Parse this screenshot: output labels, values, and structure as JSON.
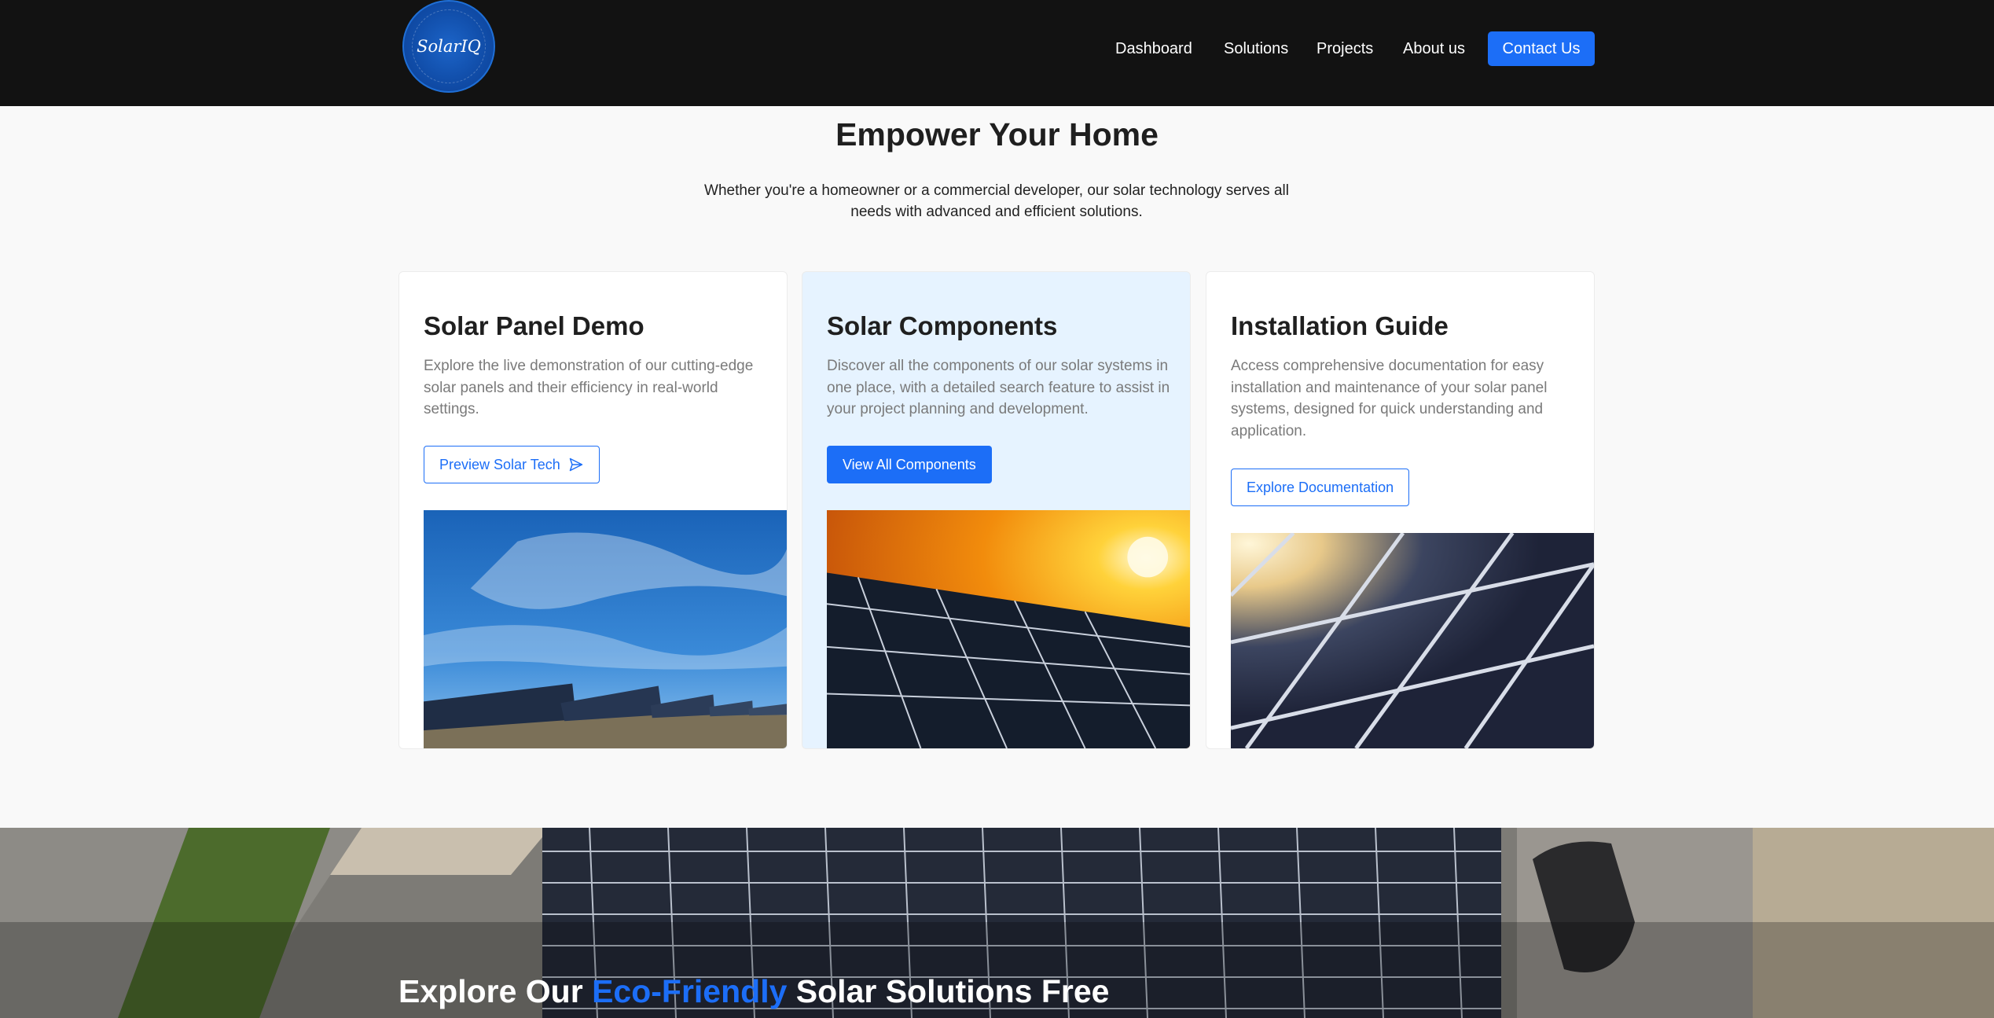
{
  "brand": {
    "logo_text": "SolarIQ"
  },
  "nav": {
    "items": [
      {
        "label": "Dashboard"
      },
      {
        "label": "Solutions"
      },
      {
        "label": "Projects"
      },
      {
        "label": "About us"
      }
    ],
    "cta_label": "Contact Us"
  },
  "hero": {
    "title": "Empower Your Home",
    "subtitle": "Whether you're a homeowner or a commercial developer, our solar technology serves all needs with advanced and efficient solutions."
  },
  "cards": [
    {
      "title": "Solar Panel Demo",
      "description": "Explore the live demonstration of our cutting-edge solar panels and their efficiency in real-world settings.",
      "button_label": "Preview Solar Tech",
      "button_icon": "send-icon"
    },
    {
      "title": "Solar Components",
      "description": "Discover all the components of our solar systems in one place, with a detailed search feature to assist in your project planning and development.",
      "button_label": "View All Components"
    },
    {
      "title": "Installation Guide",
      "description": "Access comprehensive documentation for easy installation and maintenance of your solar panel systems, designed for quick understanding and application.",
      "button_label": "Explore Documentation"
    }
  ],
  "banner": {
    "heading_pre": "Explore Our ",
    "heading_accent": "Eco-Friendly",
    "heading_post": " Solar Solutions Free"
  },
  "colors": {
    "accent": "#1c6ef7",
    "header_bg": "#121212",
    "highlight_card_bg": "#e6f3ff"
  }
}
